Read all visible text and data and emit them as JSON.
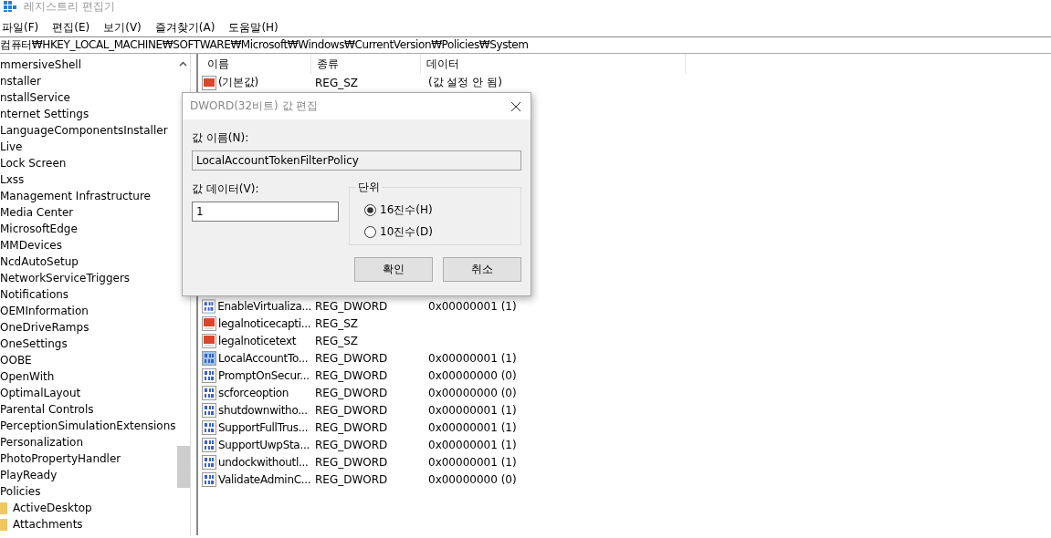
{
  "window": {
    "title": "레지스트리 편집기"
  },
  "menu": [
    "파일(F)",
    "편집(E)",
    "보기(V)",
    "즐겨찾기(A)",
    "도움말(H)"
  ],
  "address": "컴퓨터₩HKEY_LOCAL_MACHINE₩SOFTWARE₩Microsoft₩Windows₩CurrentVersion₩Policies₩System",
  "tree": [
    {
      "label": "mmersiveShell"
    },
    {
      "label": "nstaller"
    },
    {
      "label": "nstallService"
    },
    {
      "label": "nternet Settings"
    },
    {
      "label": "LanguageComponentsInstaller"
    },
    {
      "label": "Live"
    },
    {
      "label": "Lock Screen"
    },
    {
      "label": "Lxss"
    },
    {
      "label": "Management Infrastructure"
    },
    {
      "label": "Media Center"
    },
    {
      "label": "MicrosoftEdge"
    },
    {
      "label": "MMDevices"
    },
    {
      "label": "NcdAutoSetup"
    },
    {
      "label": "NetworkServiceTriggers"
    },
    {
      "label": "Notifications"
    },
    {
      "label": "OEMInformation"
    },
    {
      "label": "OneDriveRamps"
    },
    {
      "label": "OneSettings"
    },
    {
      "label": "OOBE"
    },
    {
      "label": "OpenWith"
    },
    {
      "label": "OptimalLayout"
    },
    {
      "label": "Parental Controls"
    },
    {
      "label": "PerceptionSimulationExtensions"
    },
    {
      "label": "Personalization"
    },
    {
      "label": "PhotoPropertyHandler"
    },
    {
      "label": "PlayReady"
    },
    {
      "label": "Policies",
      "children": [
        {
          "label": "ActiveDesktop"
        },
        {
          "label": "Attachments"
        }
      ]
    }
  ],
  "table": {
    "columns": [
      "이름",
      "종류",
      "데이터"
    ],
    "rows_top": [
      {
        "kind": "string",
        "name": "(기본값)",
        "type": "REG_SZ",
        "data": "(값 설정 안 됨)",
        "selected": false
      }
    ],
    "rows": [
      {
        "kind": "dword",
        "name": "EnableVirtualiza...",
        "type": "REG_DWORD",
        "data": "0x00000001 (1)",
        "selected": false
      },
      {
        "kind": "string",
        "name": "legalnoticecapti...",
        "type": "REG_SZ",
        "data": "",
        "selected": false
      },
      {
        "kind": "string",
        "name": "legalnoticetext",
        "type": "REG_SZ",
        "data": "",
        "selected": false
      },
      {
        "kind": "dword",
        "name": "LocalAccountTo...",
        "type": "REG_DWORD",
        "data": "0x00000001 (1)",
        "selected": true
      },
      {
        "kind": "dword",
        "name": "PromptOnSecur...",
        "type": "REG_DWORD",
        "data": "0x00000000 (0)",
        "selected": false
      },
      {
        "kind": "dword",
        "name": "scforceoption",
        "type": "REG_DWORD",
        "data": "0x00000000 (0)",
        "selected": false
      },
      {
        "kind": "dword",
        "name": "shutdownwitho...",
        "type": "REG_DWORD",
        "data": "0x00000001 (1)",
        "selected": false
      },
      {
        "kind": "dword",
        "name": "SupportFullTrus...",
        "type": "REG_DWORD",
        "data": "0x00000001 (1)",
        "selected": false
      },
      {
        "kind": "dword",
        "name": "SupportUwpSta...",
        "type": "REG_DWORD",
        "data": "0x00000001 (1)",
        "selected": false
      },
      {
        "kind": "dword",
        "name": "undockwithoutl...",
        "type": "REG_DWORD",
        "data": "0x00000001 (1)",
        "selected": false
      },
      {
        "kind": "dword",
        "name": "ValidateAdminC...",
        "type": "REG_DWORD",
        "data": "0x00000000 (0)",
        "selected": false
      }
    ]
  },
  "dialog": {
    "title": "DWORD(32비트) 값 편집",
    "name_label": "값 이름(N):",
    "name_value": "LocalAccountTokenFilterPolicy",
    "data_label": "값 데이터(V):",
    "data_value": "1",
    "base_label": "단위",
    "bases": [
      {
        "label": "16진수(H)",
        "selected": true
      },
      {
        "label": "10진수(D)",
        "selected": false
      }
    ],
    "buttons": [
      "확인",
      "취소"
    ]
  }
}
